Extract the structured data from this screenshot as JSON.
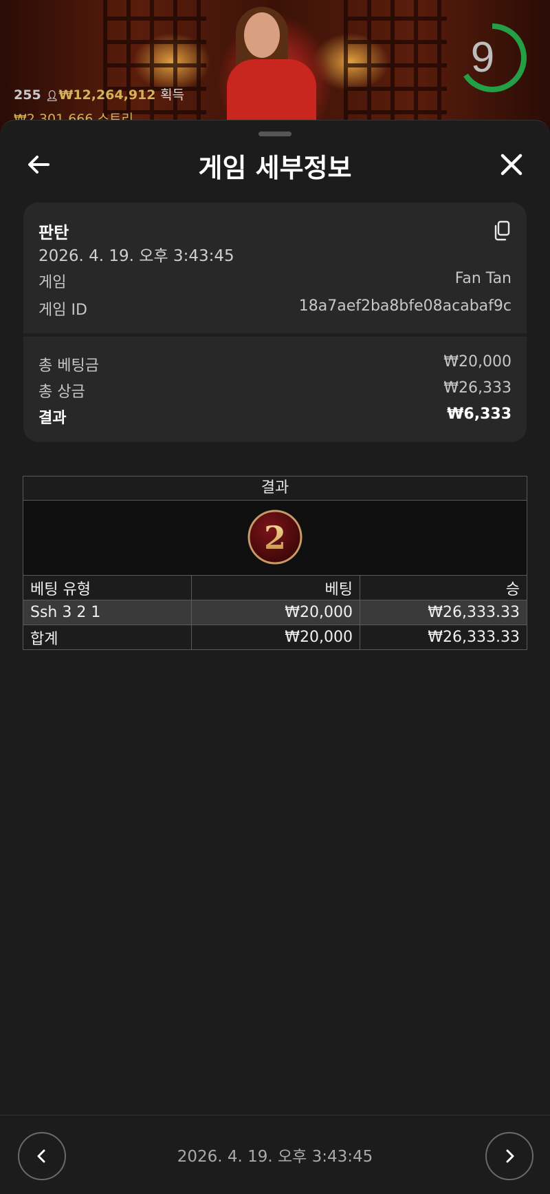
{
  "background": {
    "players": "255",
    "total_win": "₩12,264,912",
    "win_label": "획득",
    "streak_line": "₩2,301,666 스트리",
    "timer": "9"
  },
  "header": {
    "title": "게임 세부정보"
  },
  "summary": {
    "game_name": "판탄",
    "datetime": "2026. 4. 19. 오후 3:43:45",
    "game_label": "게임",
    "game_value": "Fan Tan",
    "game_id_label": "게임 ID",
    "game_id_value": "18a7aef2ba8bfe08acabaf9c",
    "total_bet_label": "총 베팅금",
    "total_bet_value": "₩20,000",
    "total_payout_label": "총 상금",
    "total_payout_value": "₩26,333",
    "result_label": "결과",
    "result_value": "₩6,333"
  },
  "result_table": {
    "header": "결과",
    "result_number": "2",
    "columns": [
      "베팅 유형",
      "베팅",
      "승"
    ],
    "rows": [
      [
        "Ssh 3 2 1",
        "₩20,000",
        "₩26,333.33"
      ],
      [
        "합계",
        "₩20,000",
        "₩26,333.33"
      ]
    ]
  },
  "footer": {
    "datetime": "2026. 4. 19. 오후 3:43:45"
  },
  "colors": {
    "timer_ring": "#23a046",
    "gold": "#d4b257",
    "ball": "#5a0d10"
  }
}
